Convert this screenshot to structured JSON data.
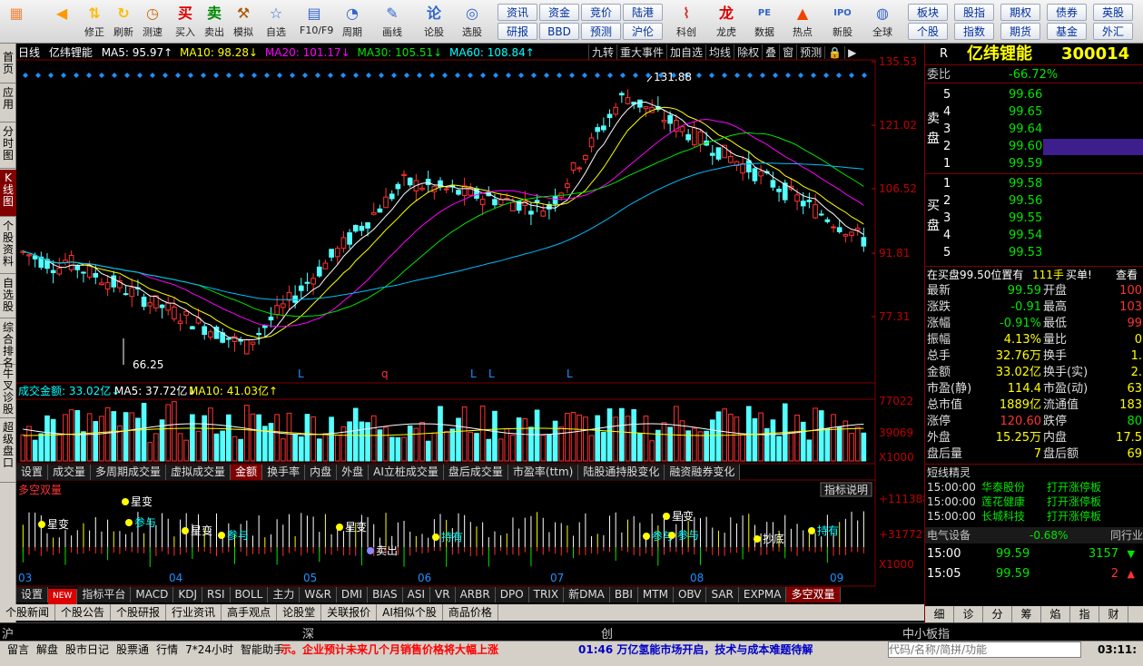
{
  "toolbar": {
    "main": [
      {
        "label": "",
        "icon": "windows-icon"
      },
      {
        "label": "",
        "icon": "back-arrow-icon"
      },
      {
        "label": "修正",
        "icon": "updown-arrows-icon"
      },
      {
        "label": "刷新",
        "icon": "refresh-icon"
      },
      {
        "label": "测速",
        "icon": "clock-icon"
      },
      {
        "label": "买入",
        "icon": "buy-icon"
      },
      {
        "label": "卖出",
        "icon": "sell-icon"
      },
      {
        "label": "模拟",
        "icon": "hammer-icon"
      },
      {
        "label": "自选",
        "icon": "folder-icon"
      },
      {
        "label": "F10/F9",
        "icon": "f10-icon"
      },
      {
        "label": "周期",
        "icon": "cycle-icon"
      },
      {
        "label": "画线",
        "icon": "pen-icon"
      },
      {
        "label": "论股",
        "icon": "chat-icon"
      },
      {
        "label": "选股",
        "icon": "chart-select-icon"
      }
    ],
    "links_top": [
      "资讯",
      "资金",
      "竞价",
      "陆港"
    ],
    "links_bottom": [
      "研报",
      "BBD",
      "预测",
      "沪伦"
    ],
    "mid": [
      {
        "label": "科创",
        "icon": "chart-icon"
      },
      {
        "label": "龙虎",
        "icon": "dragon-icon"
      },
      {
        "label": "数据",
        "icon": "pe-icon"
      },
      {
        "label": "热点",
        "icon": "hot-icon"
      },
      {
        "label": "新股",
        "icon": "ipo-icon"
      },
      {
        "label": "全球",
        "icon": "globe-icon"
      }
    ],
    "links_right_top": [
      "板块",
      "股指",
      "期权",
      "债券",
      "英股"
    ],
    "links_right_bottom": [
      "个股",
      "指数",
      "期货",
      "基金",
      "外汇"
    ]
  },
  "side_tabs": [
    "首页",
    "应用",
    "分时图",
    "K线图",
    "个股资料",
    "自选股",
    "综合排名",
    "牛叉诊股",
    "超级盘口"
  ],
  "chart": {
    "header": {
      "period": "日线",
      "name": "亿纬锂能",
      "ma5": "MA5: 95.97↑",
      "ma10": "MA10: 98.28↓",
      "ma20": "MA20: 101.17↓",
      "ma30": "MA30: 105.51↓",
      "ma60": "MA60: 108.84↑"
    },
    "right_bar": [
      "九转",
      "重大事件",
      "加自选",
      "均线",
      "除权",
      "叠",
      "窗",
      "预测",
      "🔒",
      "▶"
    ],
    "price_axis": [
      "135.53",
      "121.02",
      "106.52",
      "91.81",
      "77.31"
    ],
    "high_label": "131.88",
    "low_label": "66.25",
    "signals": [
      "L",
      "q",
      "L",
      "L",
      "L"
    ],
    "vol_header": {
      "label": "成交金额: 33.02亿↓",
      "ma5": "MA5: 37.72亿↓",
      "ma10": "MA10: 41.03亿↑"
    },
    "vol_axis": [
      "77022",
      "39069",
      "X1000"
    ],
    "vol_tabs": [
      "设置",
      "成交量",
      "多周期成交量",
      "虚拟成交量",
      "金额",
      "换手率",
      "内盘",
      "外盘",
      "AI立桩成交量",
      "盘后成交量",
      "市盈率(ttm)",
      "陆股通持股变化",
      "融资融券变化"
    ],
    "ind_title": "多空双量",
    "ind_btn": "指标说明",
    "ind_axis": [
      "+111388",
      "+31772",
      "X1000"
    ],
    "ind_marks": [
      "星变",
      "星变",
      "参与",
      "星变",
      "参与",
      "星变",
      "卖出",
      "持有",
      "参与",
      "星变",
      "参与",
      "抄底",
      "持有"
    ],
    "months": [
      "03",
      "04",
      "05",
      "06",
      "07",
      "08",
      "09"
    ],
    "ind_tabs": [
      "设置",
      "NEW",
      "指标平台",
      "MACD",
      "KDJ",
      "RSI",
      "BOLL",
      "主力",
      "W&R",
      "DMI",
      "BIAS",
      "ASI",
      "VR",
      "ARBR",
      "DPO",
      "TRIX",
      "新DMA",
      "BBI",
      "MTM",
      "OBV",
      "SAR",
      "EXPMA",
      "多空双量"
    ]
  },
  "bottom_tabs": [
    "个股新闻",
    "个股公告",
    "个股研报",
    "行业资讯",
    "高手观点",
    "论股堂",
    "关联报价",
    "AI相似个股",
    "商品价格"
  ],
  "markets": [
    "沪",
    "深",
    "创",
    "中小板指"
  ],
  "status": {
    "items": [
      "留言",
      "解盘",
      "股市日记",
      "股票通",
      "行情",
      "7*24小时",
      "智能助手"
    ],
    "ticker1": "示。企业预计未来几个月销售价格将大幅上涨",
    "ticker2": "01:46 万亿氢能市场开启，技术与成本难题待解",
    "search_ph": "代码/名称/简拼/功能",
    "time": "03:11:"
  },
  "quote": {
    "code_letter": "R",
    "name": "亿纬锂能",
    "code": "300014",
    "ratio_label": "委比",
    "ratio": "-66.72%",
    "sell_label": "卖盘",
    "buy_label": "买盘",
    "sell": [
      {
        "lv": "5",
        "p": "99.66"
      },
      {
        "lv": "4",
        "p": "99.65"
      },
      {
        "lv": "3",
        "p": "99.64"
      },
      {
        "lv": "2",
        "p": "99.60"
      },
      {
        "lv": "1",
        "p": "99.59"
      }
    ],
    "buy": [
      {
        "lv": "1",
        "p": "99.58"
      },
      {
        "lv": "2",
        "p": "99.56"
      },
      {
        "lv": "3",
        "p": "99.55"
      },
      {
        "lv": "4",
        "p": "99.54"
      },
      {
        "lv": "5",
        "p": "99.53"
      }
    ],
    "tip": "在买盘99.50位置有",
    "tip_hands": "111手",
    "tip_buy": "买单!",
    "tip_view": "查看",
    "stats": [
      [
        "最新",
        "99.59",
        "开盘",
        "100"
      ],
      [
        "涨跌",
        "-0.91",
        "最高",
        "103"
      ],
      [
        "涨幅",
        "-0.91%",
        "最低",
        "99"
      ],
      [
        "振幅",
        "4.13%",
        "量比",
        "0"
      ],
      [
        "总手",
        "32.76万",
        "换手",
        "1."
      ],
      [
        "金额",
        "33.02亿",
        "换手(实)",
        "2."
      ],
      [
        "市盈(静)",
        "114.4",
        "市盈(动)",
        "63"
      ],
      [
        "总市值",
        "1889亿",
        "流通值",
        "183"
      ],
      [
        "涨停",
        "120.60",
        "跌停",
        "80"
      ],
      [
        "外盘",
        "15.25万",
        "内盘",
        "17.5"
      ],
      [
        "盘后量",
        "7",
        "盘后额",
        "69"
      ]
    ],
    "news_title": "短线精灵",
    "news": [
      [
        "15:00:00",
        "华泰股份",
        "打开涨停板"
      ],
      [
        "15:00:00",
        "莲花健康",
        "打开涨停板"
      ],
      [
        "15:00:00",
        "长城科技",
        "打开涨停板"
      ]
    ],
    "sector": "电气设备",
    "sector_chg": "-0.68%",
    "sector_link": "同行业比",
    "ticks": [
      [
        "15:00",
        "99.59",
        "3157"
      ],
      [
        "15:05",
        "99.59",
        "2"
      ]
    ],
    "bottom_tabs": [
      "细",
      "诊",
      "分",
      "筹",
      "焰",
      "指",
      "财"
    ]
  }
}
